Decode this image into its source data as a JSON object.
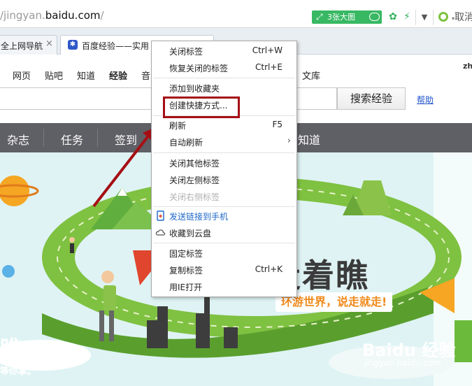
{
  "address_bar": {
    "url_prefix": "/jingyan.",
    "url_host": "baidu.com",
    "url_suffix": "/",
    "bigpic_label": "3张大图",
    "cancel_label": "取消"
  },
  "tabs": [
    {
      "label": "全上网导航",
      "close": "×"
    },
    {
      "label": "百度经验——实用",
      "close": ""
    }
  ],
  "nav": {
    "items": [
      "网页",
      "贴吧",
      "知道",
      "经验",
      "音",
      "文库"
    ],
    "user_abbrev": "zh"
  },
  "search": {
    "button": "搜索经验",
    "help": "帮助"
  },
  "categories": [
    "杂志",
    "任务",
    "签到",
    "知道"
  ],
  "banner": {
    "big_text": "走着瞧",
    "sub_text": "环游世界，说走就走!",
    "left_title": "瞧",
    "left_slogan": "等你拿。",
    "watermark_logo": "Baidu 经验",
    "watermark_url": "jingyan.baidu.com"
  },
  "context_menu": {
    "items": [
      {
        "label": "关闭标签",
        "shortcut": "Ctrl+W"
      },
      {
        "label": "恢复关闭的标签",
        "shortcut": "Ctrl+E"
      },
      {
        "label": "添加到收藏夹",
        "shortcut": ""
      },
      {
        "label": "创建快捷方式...",
        "shortcut": ""
      },
      {
        "label": "刷新",
        "shortcut": "F5"
      },
      {
        "label": "自动刷新",
        "shortcut": ""
      },
      {
        "label": "关闭其他标签",
        "shortcut": ""
      },
      {
        "label": "关闭左侧标签",
        "shortcut": ""
      },
      {
        "label": "关闭右侧标签",
        "shortcut": ""
      },
      {
        "label": "发送链接到手机",
        "shortcut": ""
      },
      {
        "label": "收藏到云盘",
        "shortcut": ""
      },
      {
        "label": "固定标签",
        "shortcut": ""
      },
      {
        "label": "复制标签",
        "shortcut": "Ctrl+K"
      },
      {
        "label": "用IE打开",
        "shortcut": ""
      }
    ]
  },
  "colors": {
    "accent_green": "#38b863",
    "category_bar": "#5f5f66",
    "annotation_red": "#a50f14",
    "link_blue": "#1d67c8"
  }
}
